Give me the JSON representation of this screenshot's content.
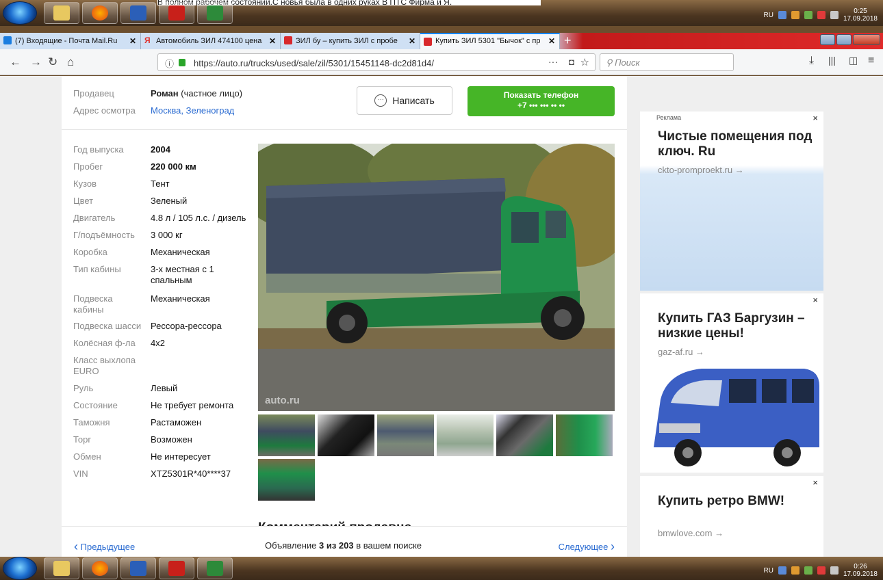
{
  "os": {
    "top_clock": {
      "time": "0:25",
      "date": "17.09.2018"
    },
    "bottom_clock": {
      "time": "0:26",
      "date": "17.09.2018"
    },
    "lang": "RU",
    "top_strip_text": "В полном рабочем состоянии.С новья была в одних руках В ПТС Фирма и Я."
  },
  "browser": {
    "tabs": [
      {
        "label": "(7) Входящие - Почта Mail.Ru",
        "icon": "mail-icon",
        "color": "#1a7de0"
      },
      {
        "label": "Автомобиль ЗИЛ 474100 цена",
        "icon": "yandex-icon",
        "color": "#e0302a"
      },
      {
        "label": "ЗИЛ бу – купить ЗИЛ с пробе",
        "icon": "autoru-icon",
        "color": "#d8282c"
      },
      {
        "label": "Купить ЗИЛ 5301 \"Бычок\" с пр",
        "icon": "autoru-icon",
        "color": "#d8282c"
      }
    ],
    "close_glyph": "✕",
    "new_tab": "+",
    "url": "https://auto.ru/trucks/used/sale/zil/5301/15451148-dc2d81d4/",
    "url_host": "auto.ru",
    "search_placeholder": "Поиск",
    "more_glyph": "···"
  },
  "seller": {
    "label": "Продавец",
    "name": "Роман",
    "type": "(частное лицо)",
    "address_label": "Адрес осмотра",
    "address": "Москва, Зеленоград",
    "write_button": "Написать",
    "phone_button": "Показать телефон",
    "phone_masked": "+7 ••• ••• •• ••"
  },
  "specs": [
    {
      "k": "Год выпуска",
      "v": "2004",
      "bold": true
    },
    {
      "k": "Пробег",
      "v": "220 000 км",
      "bold": true
    },
    {
      "k": "Кузов",
      "v": "Тент"
    },
    {
      "k": "Цвет",
      "v": "Зеленый"
    },
    {
      "k": "Двигатель",
      "v": "4.8 л / 105 л.с. / дизель"
    },
    {
      "k": "Г/подъёмность",
      "v": "3 000 кг"
    },
    {
      "k": "Коробка",
      "v": "Механическая"
    },
    {
      "k": "Тип кабины",
      "v": "3-х местная с 1 спальным"
    },
    {
      "k": "Подвеска кабины",
      "v": "Механическая"
    },
    {
      "k": "Подвеска шасси",
      "v": "Рессора-рессора"
    },
    {
      "k": "Колёсная ф-ла",
      "v": "4x2"
    },
    {
      "k": "Класс выхлопа EURO",
      "v": ""
    },
    {
      "k": "Руль",
      "v": "Левый"
    },
    {
      "k": "Состояние",
      "v": "Не требует ремонта"
    },
    {
      "k": "Таможня",
      "v": "Растаможен"
    },
    {
      "k": "Торг",
      "v": "Возможен"
    },
    {
      "k": "Обмен",
      "v": "Не интересует"
    },
    {
      "k": "VIN",
      "v": "XTZ5301R*40****37"
    }
  ],
  "photo": {
    "watermark": "auto.ru"
  },
  "comment_heading": "Комментарий продавца",
  "pager": {
    "prev": "Предыдущее",
    "next": "Следующее",
    "text_before": "Объявление ",
    "current": "3 из 203",
    "text_after": " в вашем поиске"
  },
  "ads": [
    {
      "badge": "Реклама",
      "title": "Чистые помещения под ключ. Ru",
      "domain": "ckto-promproekt.ru →"
    },
    {
      "title": "Купить ГАЗ Баргузин – низкие цены!",
      "domain": "gaz-af.ru →"
    },
    {
      "title": "Купить ретро BMW!",
      "domain": "bmwlove.com →"
    }
  ],
  "close_mark": "×"
}
